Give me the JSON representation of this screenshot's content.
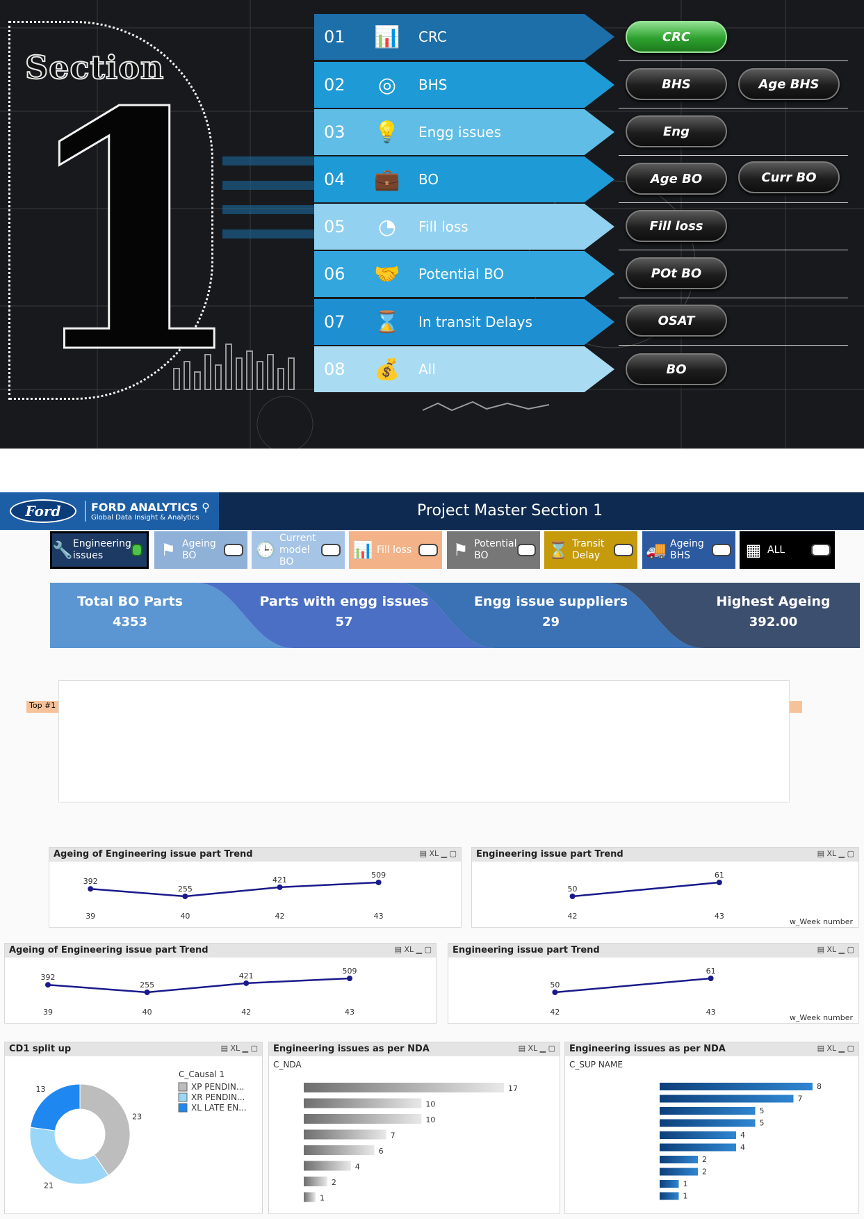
{
  "menu": {
    "section_word": "Section",
    "section_number": "1",
    "items": [
      {
        "num": "01",
        "label": "CRC",
        "icon": "chart-search-icon",
        "color": "#1c6fa8"
      },
      {
        "num": "02",
        "label": "BHS",
        "icon": "target-icon",
        "color": "#1e9ad6"
      },
      {
        "num": "03",
        "label": "Engg issues",
        "icon": "lightbulb-icon",
        "color": "#5fbde6"
      },
      {
        "num": "04",
        "label": "BO",
        "icon": "briefcase-icon",
        "color": "#1e9ad6"
      },
      {
        "num": "05",
        "label": "Fill loss",
        "icon": "pie-icon",
        "color": "#92d1ef"
      },
      {
        "num": "06",
        "label": "Potential BO",
        "icon": "handshake-icon",
        "color": "#33a6dd"
      },
      {
        "num": "07",
        "label": "In transit Delays",
        "icon": "hourglass-icon",
        "color": "#1e8fd0"
      },
      {
        "num": "08",
        "label": "All",
        "icon": "money-bag-icon",
        "color": "#a9dcf2"
      }
    ],
    "pills": {
      "crc": "CRC",
      "bhs": "BHS",
      "age_bhs": "Age BHS",
      "eng": "Eng",
      "age_bo": "Age BO",
      "curr_bo": "Curr BO",
      "fill_loss": "Fill loss",
      "pot_bo": "POt BO",
      "osat": "OSAT",
      "bo": "BO"
    }
  },
  "dashboard": {
    "brand": "Ford",
    "brand_title": "FORD ANALYTICS",
    "brand_sub": "Global Data Insight & Analytics",
    "title": "Project Master Section 1",
    "tabs": [
      {
        "label": "Engineering issues",
        "icon": "wrench-icon",
        "color": "#1c3a64",
        "on": true
      },
      {
        "label": "Ageing BO",
        "icon": "flag-x-icon",
        "color": "#8fb1d8",
        "on": false
      },
      {
        "label": "Current model BO",
        "icon": "clock-icon",
        "color": "#a6c4e6",
        "on": false
      },
      {
        "label": "Fill loss",
        "icon": "chart-search-icon",
        "color": "#f3b287",
        "on": false
      },
      {
        "label": "Potential BO",
        "icon": "flag-icon",
        "color": "#777777",
        "on": false
      },
      {
        "label": "Transit Delay",
        "icon": "hourglass-icon",
        "color": "#c59a0b",
        "on": false
      },
      {
        "label": "Ageing BHS",
        "icon": "truck-icon",
        "color": "#2c5aa0",
        "on": false
      },
      {
        "label": "ALL",
        "icon": "grid-icon",
        "color": "#000000",
        "on": false
      }
    ],
    "kpis": [
      {
        "label": "Total BO Parts",
        "value": "4353",
        "color": "#5b96d3"
      },
      {
        "label": "Parts with engg issues",
        "value": "57",
        "color": "#4a6fc4"
      },
      {
        "label": "Engg issue suppliers",
        "value": "29",
        "color": "#3a72b5"
      },
      {
        "label": "Highest Ageing",
        "value": "392.00",
        "color": "#3c4f6e"
      }
    ],
    "top_tag": "Top #1",
    "tools": "XL"
  },
  "chart_data": [
    {
      "type": "line",
      "title": "Ageing of Engineering issue part Trend",
      "x": [
        "39",
        "40",
        "42",
        "43"
      ],
      "values": [
        392,
        255,
        421,
        509
      ],
      "xlabel": "",
      "ylabel": ""
    },
    {
      "type": "line",
      "title": "Engineering issue part Trend",
      "x": [
        "42",
        "43"
      ],
      "values": [
        50,
        61
      ],
      "xlabel": "w_Week number",
      "ylabel": ""
    },
    {
      "type": "line",
      "title": "Ageing of Engineering issue part Trend",
      "x": [
        "39",
        "40",
        "42",
        "43"
      ],
      "values": [
        392,
        255,
        421,
        509
      ],
      "xlabel": "",
      "ylabel": ""
    },
    {
      "type": "line",
      "title": "Engineering issue part Trend",
      "x": [
        "42",
        "43"
      ],
      "values": [
        50,
        61
      ],
      "xlabel": "w_Week number",
      "ylabel": ""
    },
    {
      "type": "pie",
      "title": "CD1 split up",
      "legend_title": "C_Causal 1",
      "categories": [
        "XP PENDIN...",
        "XR PENDIN...",
        "XL LATE EN..."
      ],
      "values": [
        23,
        21,
        13
      ],
      "colors": [
        "#bdbdbd",
        "#9ad6f7",
        "#1e88f0"
      ]
    },
    {
      "type": "bar",
      "title": "Engineering issues as per NDA",
      "dimension": "C_NDA",
      "values": [
        17,
        10,
        10,
        7,
        6,
        4,
        2,
        1
      ],
      "color": "#8a8a8a"
    },
    {
      "type": "bar",
      "title": "Engineering issues as per NDA",
      "dimension": "C_SUP NAME",
      "values": [
        8,
        7,
        5,
        5,
        4,
        4,
        2,
        2,
        1,
        1
      ],
      "color": "#1f5fa8"
    }
  ]
}
